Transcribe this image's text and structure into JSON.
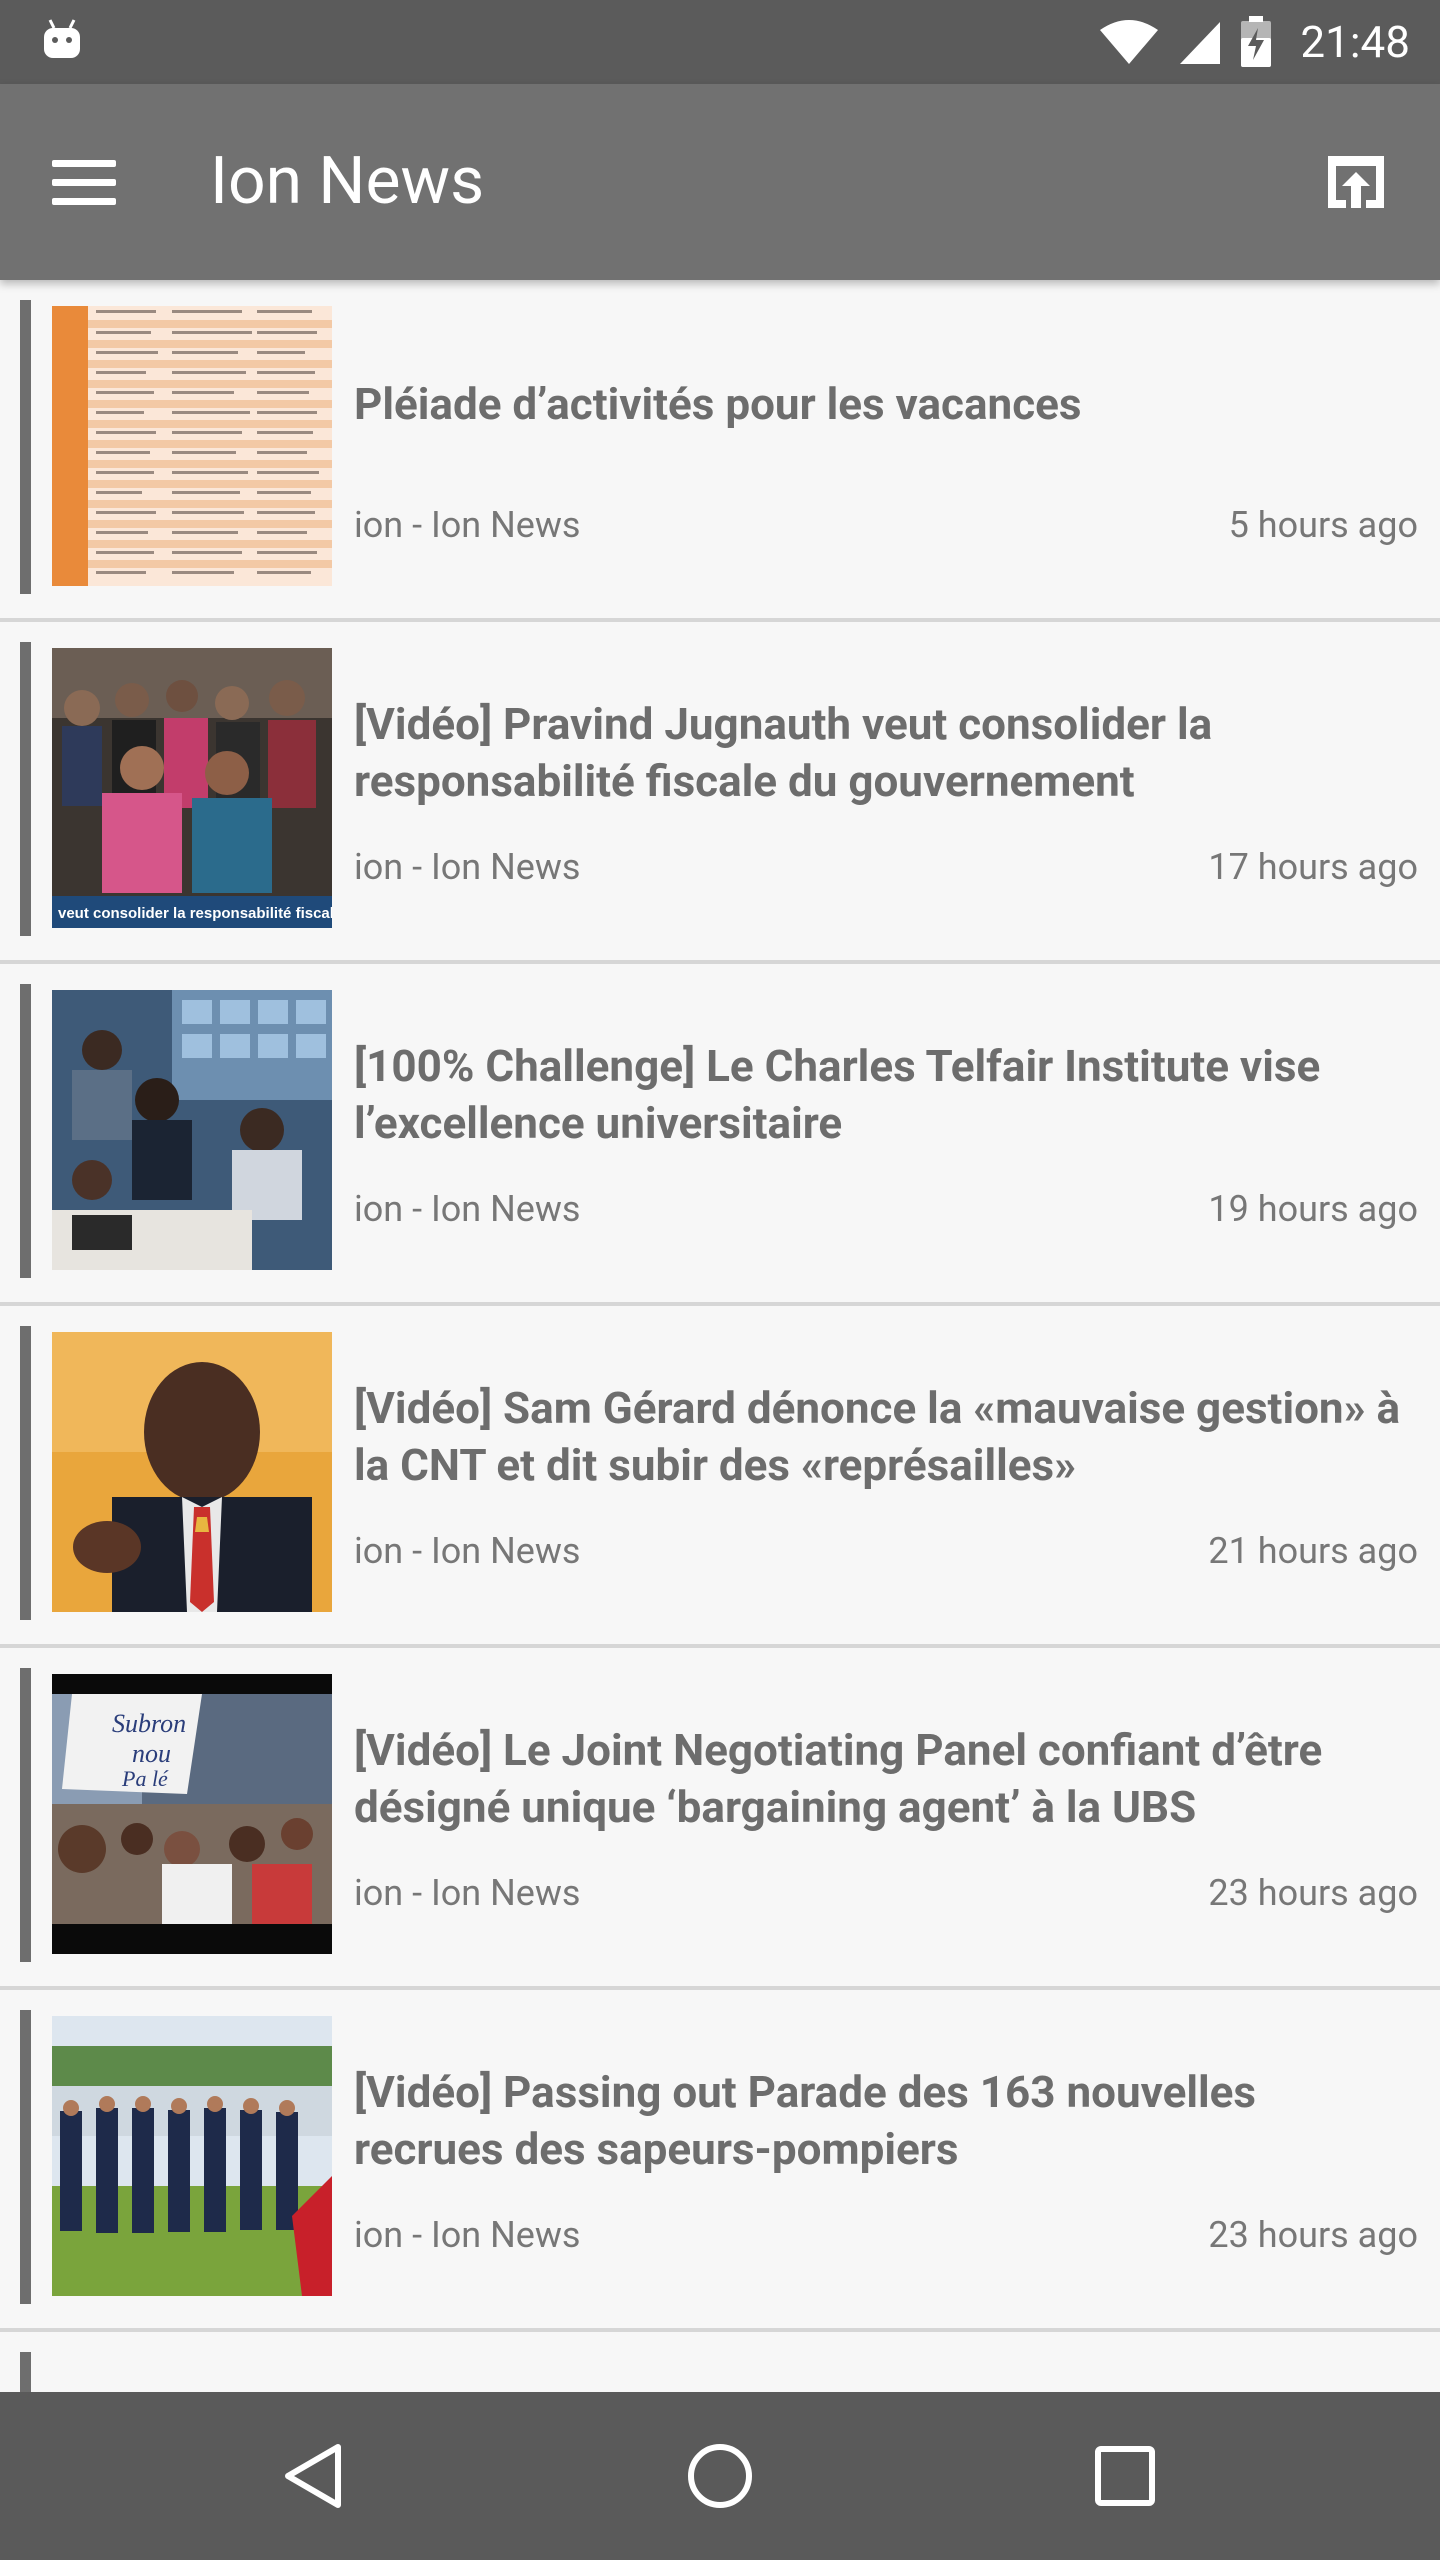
{
  "status_bar": {
    "time": "21:48"
  },
  "app_bar": {
    "title": "Ion News"
  },
  "articles": [
    {
      "title": "Pléiade d’activités pour les vacances",
      "source": "ion - Ion News",
      "time": "5 hours ago"
    },
    {
      "title": "[Vidéo] Pravind Jugnauth veut consolider la responsabilité fiscale du gouvernement",
      "source": "ion - Ion News",
      "time": "17 hours ago",
      "thumb_caption": "veut consolider la responsabilité fiscale du"
    },
    {
      "title": "[100% Challenge] Le Charles Telfair Institute vise l’excellence universitaire",
      "source": "ion - Ion News",
      "time": "19 hours ago"
    },
    {
      "title": "[Vidéo] Sam Gérard dénonce la «mauvaise gestion» à la CNT et dit subir des «représailles»",
      "source": "ion - Ion News",
      "time": "21 hours ago"
    },
    {
      "title": "[Vidéo] Le Joint Negotiating Panel confiant d’être désigné unique ‘bargaining agent’ à la UBS",
      "source": "ion - Ion News",
      "time": "23 hours ago",
      "thumb_banner": "Subron nou Pa lé"
    },
    {
      "title": "[Vidéo] Passing out Parade des 163 nouvelles recrues des sapeurs-pompiers",
      "source": "ion - Ion News",
      "time": "23 hours ago"
    }
  ]
}
